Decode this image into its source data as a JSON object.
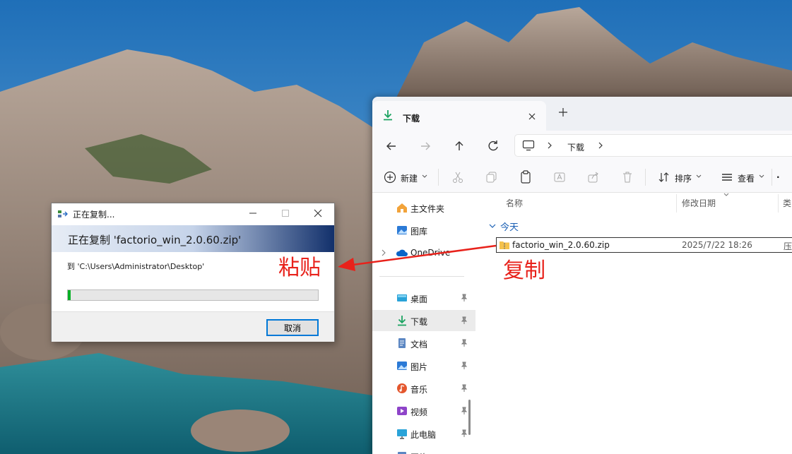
{
  "explorer": {
    "tab_title": "下载",
    "address_segment": "下载",
    "toolbar": {
      "new_label": "新建",
      "sort_label": "排序",
      "view_label": "查看",
      "more_label": "·"
    },
    "nav_items": [
      {
        "label": "主文件夹",
        "icon": "home-icon"
      },
      {
        "label": "图库",
        "icon": "gallery-icon"
      },
      {
        "label": "OneDrive",
        "icon": "cloud-icon"
      },
      {
        "label": "桌面",
        "icon": "desktop-icon"
      },
      {
        "label": "下载",
        "icon": "download-icon"
      },
      {
        "label": "文档",
        "icon": "document-icon"
      },
      {
        "label": "图片",
        "icon": "pictures-icon"
      },
      {
        "label": "音乐",
        "icon": "music-icon"
      },
      {
        "label": "视频",
        "icon": "video-icon"
      },
      {
        "label": "此电脑",
        "icon": "computer-icon"
      },
      {
        "label": "网络",
        "icon": "network-icon"
      }
    ],
    "columns": {
      "name": "名称",
      "modified": "修改日期",
      "type": "类"
    },
    "group_label": "今天",
    "file": {
      "name": "factorio_win_2.0.60.zip",
      "date": "2025/7/22 18:26",
      "type": "压"
    }
  },
  "dialog": {
    "title": "正在复制...",
    "heading": "正在复制 'factorio_win_2.0.60.zip'",
    "destination": "到 'C:\\Users\\Administrator\\Desktop'",
    "progress": 0.01,
    "cancel_label": "取消"
  },
  "annotations": {
    "paste": "粘贴",
    "copy": "复制",
    "color": "#e8221b"
  },
  "colors": {
    "accent": "#0078d7",
    "progress": "#06b025",
    "download_icon": "#1aa260"
  }
}
